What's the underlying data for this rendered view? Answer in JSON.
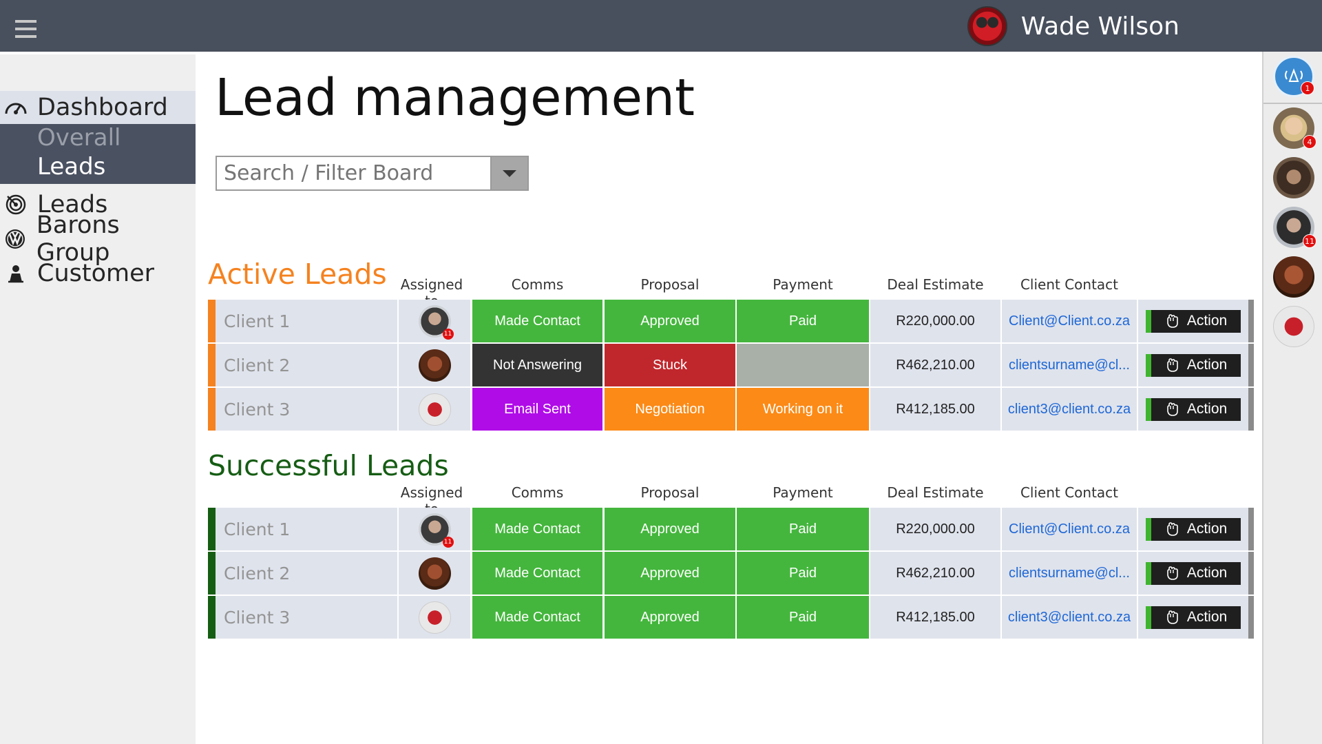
{
  "user": {
    "name": "Wade Wilson"
  },
  "sidebar": {
    "items": [
      {
        "label": "Dashboard",
        "icon": "speedometer-icon"
      },
      {
        "label": "Leads",
        "icon": "target-icon"
      },
      {
        "label": "Barons Group",
        "icon": "vw-logo-icon"
      },
      {
        "label": "Customer",
        "icon": "person-icon"
      }
    ],
    "subitems": [
      {
        "label": "Overall",
        "active": false
      },
      {
        "label": "Leads",
        "active": true
      }
    ]
  },
  "page": {
    "title": "Lead management"
  },
  "search": {
    "placeholder": "Search / Filter Board"
  },
  "columns": {
    "assigned": "Assigned to",
    "comms": "Comms",
    "proposal": "Proposal",
    "payment": "Payment",
    "deal": "Deal Estimate",
    "contact": "Client Contact"
  },
  "active": {
    "title": "Active Leads",
    "color": "#f5821f",
    "rows": [
      {
        "client": "Client 1",
        "assignee_badge": "11",
        "comms": "Made Contact",
        "comms_color": "#44b63d",
        "proposal": "Approved",
        "proposal_color": "#44b63d",
        "payment": "Paid",
        "payment_color": "#44b63d",
        "deal": "R220,000.00",
        "contact": "Client@Client.co.za",
        "action": "Action"
      },
      {
        "client": "Client 2",
        "assignee_badge": "",
        "comms": "Not Answering",
        "comms_color": "#333333",
        "proposal": "Stuck",
        "proposal_color": "#c0272d",
        "payment": "",
        "payment_color": "#a8b0a8",
        "deal": "R462,210.00",
        "contact": "clientsurname@cl...",
        "action": "Action"
      },
      {
        "client": "Client 3",
        "assignee_badge": "",
        "comms": "Email Sent",
        "comms_color": "#b00ce8",
        "proposal": "Negotiation",
        "proposal_color": "#fc8a16",
        "payment": "Working on it",
        "payment_color": "#fc8a16",
        "deal": "R412,185.00",
        "contact": "client3@client.co.za",
        "action": "Action"
      }
    ]
  },
  "successful": {
    "title": "Successful Leads",
    "color": "#165d14",
    "rows": [
      {
        "client": "Client 1",
        "assignee_badge": "11",
        "comms": "Made Contact",
        "comms_color": "#44b63d",
        "proposal": "Approved",
        "proposal_color": "#44b63d",
        "payment": "Paid",
        "payment_color": "#44b63d",
        "deal": "R220,000.00",
        "contact": "Client@Client.co.za",
        "action": "Action"
      },
      {
        "client": "Client 2",
        "assignee_badge": "",
        "comms": "Made Contact",
        "comms_color": "#44b63d",
        "proposal": "Approved",
        "proposal_color": "#44b63d",
        "payment": "Paid",
        "payment_color": "#44b63d",
        "deal": "R462,210.00",
        "contact": "clientsurname@cl...",
        "action": "Action"
      },
      {
        "client": "Client 3",
        "assignee_badge": "",
        "comms": "Made Contact",
        "comms_color": "#44b63d",
        "proposal": "Approved",
        "proposal_color": "#44b63d",
        "payment": "Paid",
        "payment_color": "#44b63d",
        "deal": "R412,185.00",
        "contact": "client3@client.co.za",
        "action": "Action"
      }
    ]
  },
  "rightbar": {
    "alert_badge": "1",
    "contacts": [
      {
        "badge": "4"
      },
      {
        "badge": ""
      },
      {
        "badge": "11"
      },
      {
        "badge": ""
      },
      {
        "badge": ""
      }
    ]
  }
}
